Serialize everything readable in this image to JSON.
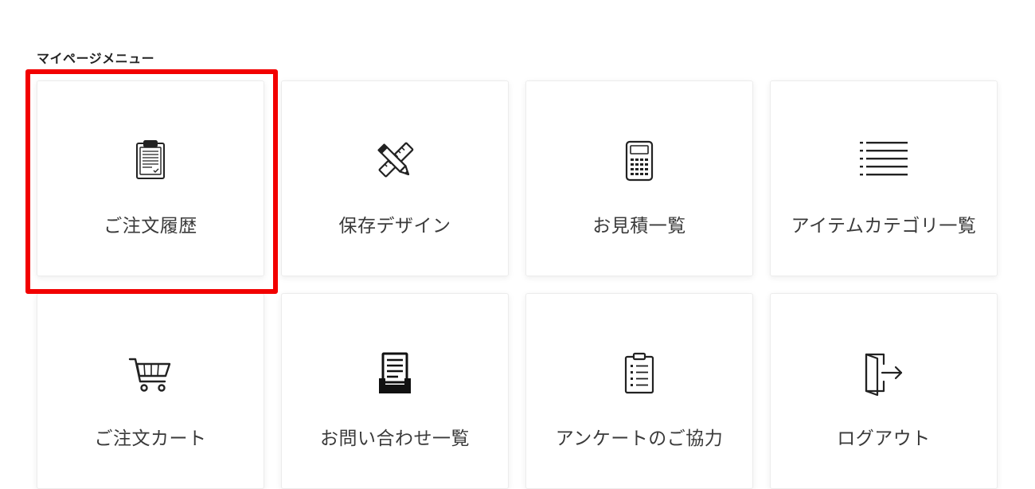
{
  "menu": {
    "title": "マイページメニュー",
    "items": [
      {
        "label": "ご注文履歴",
        "icon": "clipboard-icon"
      },
      {
        "label": "保存デザイン",
        "icon": "pencil-ruler-icon"
      },
      {
        "label": "お見積一覧",
        "icon": "calculator-icon"
      },
      {
        "label": "アイテムカテゴリ一覧",
        "icon": "list-icon"
      },
      {
        "label": "ご注文カート",
        "icon": "cart-icon"
      },
      {
        "label": "お問い合わせ一覧",
        "icon": "inbox-tray-icon"
      },
      {
        "label": "アンケートのご協力",
        "icon": "checklist-clipboard-icon"
      },
      {
        "label": "ログアウト",
        "icon": "logout-icon"
      }
    ]
  },
  "colors": {
    "highlight": "#f20000"
  }
}
